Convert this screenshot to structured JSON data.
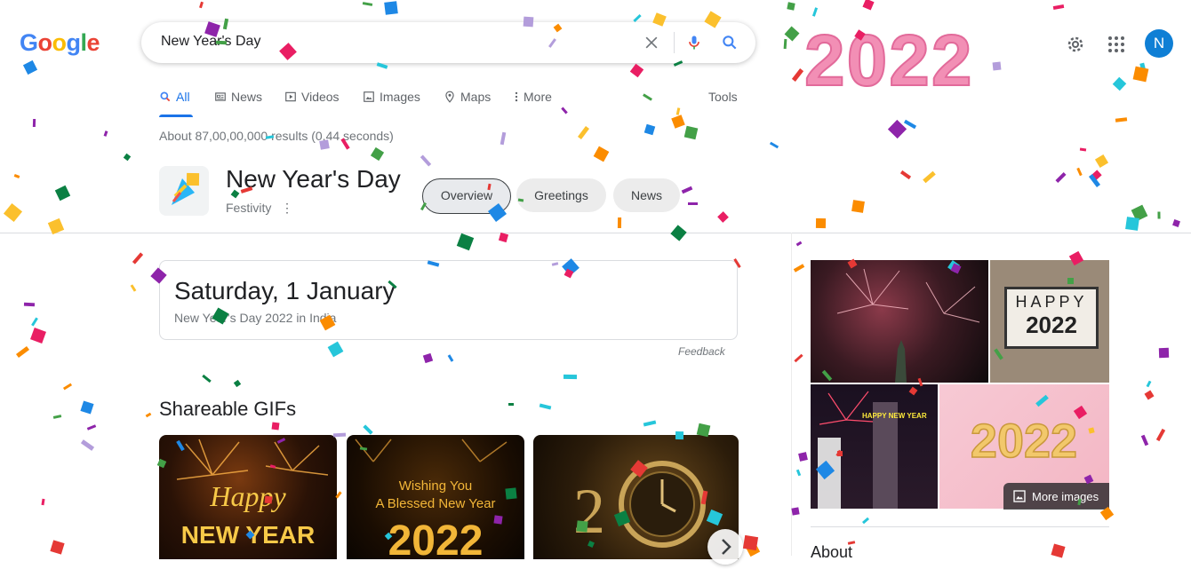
{
  "logo": {
    "letters": [
      {
        "ch": "G",
        "color": "#4285f4"
      },
      {
        "ch": "o",
        "color": "#ea4335"
      },
      {
        "ch": "o",
        "color": "#fbbc05"
      },
      {
        "ch": "g",
        "color": "#4285f4"
      },
      {
        "ch": "l",
        "color": "#34a853"
      },
      {
        "ch": "e",
        "color": "#ea4335"
      }
    ],
    "doodle_text": "2022"
  },
  "search": {
    "query": "New Year's Day",
    "clear_icon": "close-icon",
    "voice_icon": "mic-icon",
    "search_icon": "search-icon"
  },
  "header": {
    "settings_icon": "gear-icon",
    "apps_icon": "apps-grid-icon",
    "avatar_letter": "N",
    "avatar_color": "#0f7fd5"
  },
  "tabs": {
    "items": [
      {
        "label": "All",
        "icon": "search-icon",
        "active": true
      },
      {
        "label": "News",
        "icon": "news-icon",
        "active": false
      },
      {
        "label": "Videos",
        "icon": "video-icon",
        "active": false
      },
      {
        "label": "Images",
        "icon": "image-icon",
        "active": false
      },
      {
        "label": "Maps",
        "icon": "map-pin-icon",
        "active": false
      },
      {
        "label": "More",
        "icon": "more-vert-icon",
        "active": false
      }
    ],
    "tools_label": "Tools"
  },
  "result_stats": "About 87,00,00,000 results (0.44 seconds)",
  "knowledge_panel": {
    "title": "New Year's Day",
    "subtitle": "Festivity",
    "chips": [
      {
        "label": "Overview",
        "selected": true
      },
      {
        "label": "Greetings",
        "selected": false
      },
      {
        "label": "News",
        "selected": false
      }
    ]
  },
  "date_card": {
    "date": "Saturday, 1 January",
    "subtitle": "New Year's Day 2022 in India",
    "feedback": "Feedback"
  },
  "gifs": {
    "title": "Shareable GIFs",
    "items": [
      {
        "line1": "Happy",
        "line2": "NEW YEAR"
      },
      {
        "line1": "Wishing You",
        "line2": "A Blessed New Year",
        "line3": "2022"
      },
      {
        "line1": "2",
        "line2": "0"
      }
    ]
  },
  "images_panel": {
    "tiles": [
      {
        "alt": "fireworks over statue"
      },
      {
        "alt": "HAPPY 2022 lightbox",
        "line1": "HAPPY",
        "line2": "2022"
      },
      {
        "alt": "Times Square fireworks",
        "sign": "HAPPY NEW YEAR"
      },
      {
        "alt": "gold 2022 balloons",
        "text": "2022"
      }
    ],
    "more_label": "More images"
  },
  "about_heading": "About",
  "colors": {
    "accent": "#1a73e8",
    "confetti": [
      "#e91e63",
      "#1e88e5",
      "#43a047",
      "#fbc02d",
      "#8e24aa",
      "#26c6da",
      "#fb8c00",
      "#e53935",
      "#0b8043",
      "#b39ddb"
    ]
  }
}
